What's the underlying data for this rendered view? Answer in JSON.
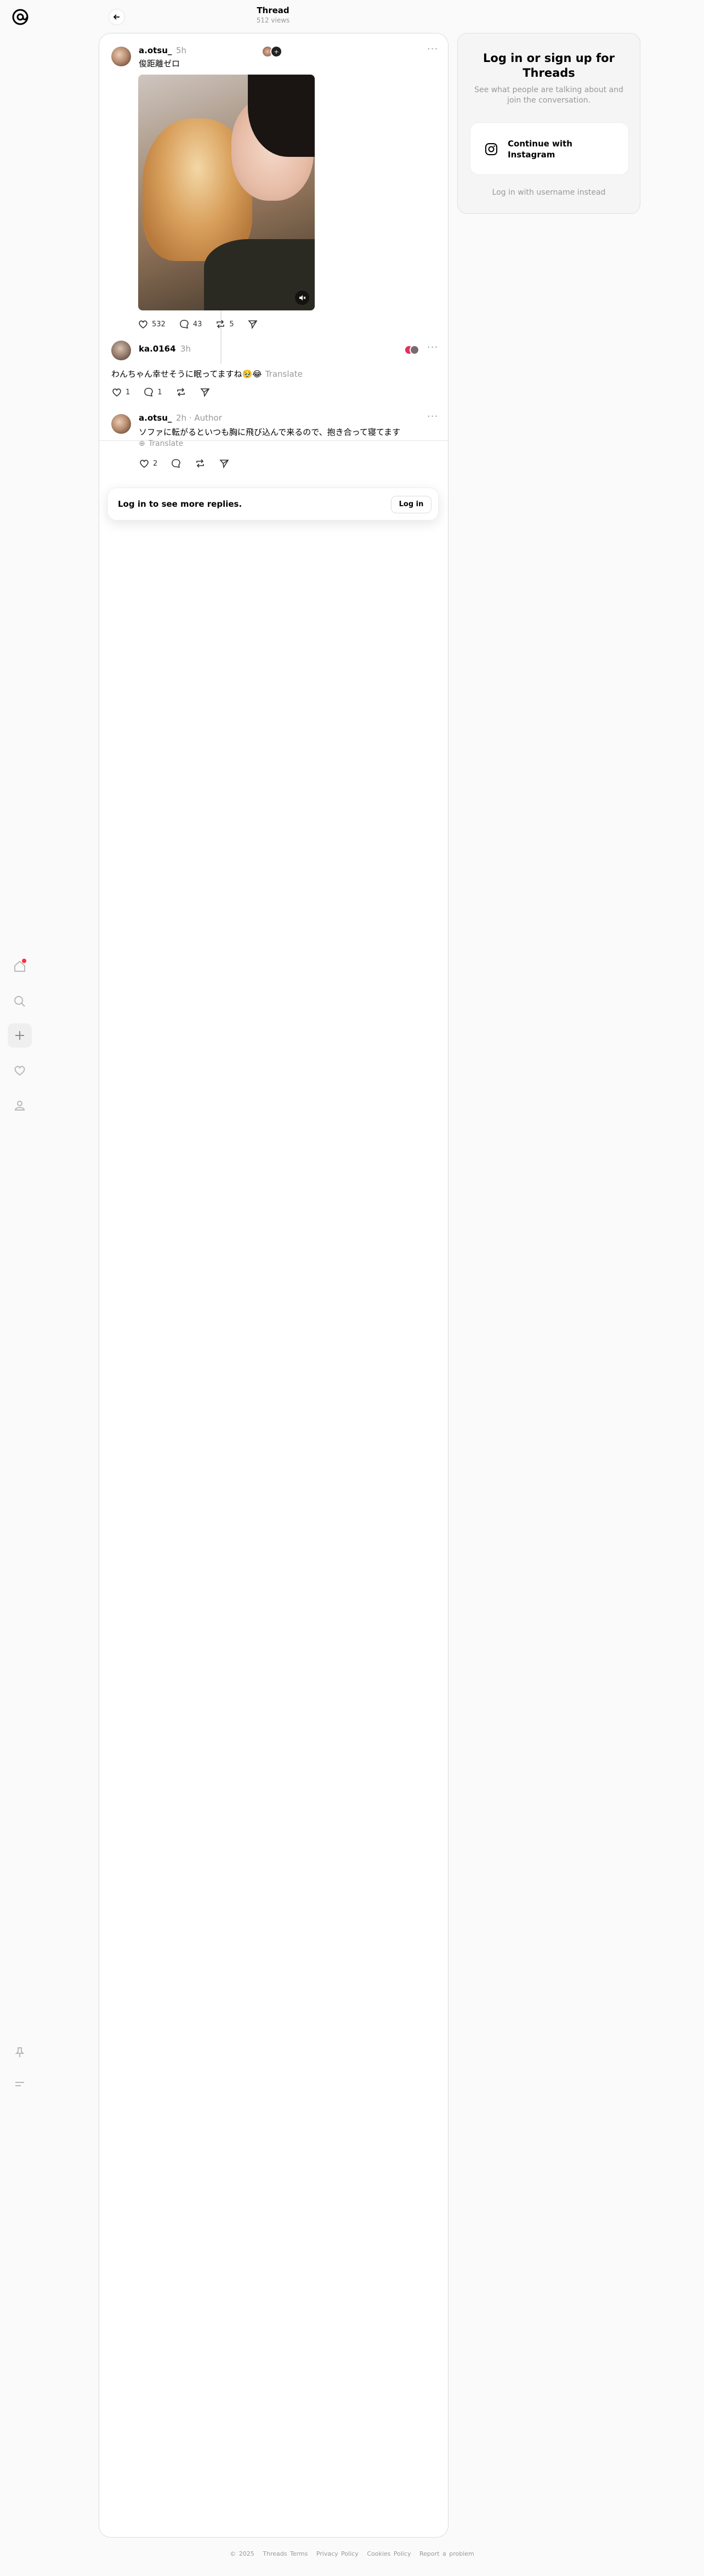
{
  "header": {
    "title": "Thread",
    "views": "512 views"
  },
  "post": {
    "username": "a.otsu_",
    "time": "5h",
    "text": "俊距離ゼロ",
    "likes": "532",
    "replies": "43",
    "reposts": "5"
  },
  "reply1": {
    "username": "ka.0164",
    "time": "3h",
    "text": "わんちゃん幸せそうに眠ってますね🥹😂",
    "translate": "Translate",
    "likes": "1",
    "replies": "1"
  },
  "reply2": {
    "username": "a.otsu_",
    "time": "2h",
    "author": "Author",
    "text": "ソファに転がるといつも胸に飛び込んで来るので、抱き合って寝てます",
    "translate": "Translate",
    "likes": "2"
  },
  "login_bar": {
    "text": "Log in to see more replies.",
    "button": "Log in"
  },
  "side": {
    "title": "Log in or sign up for Threads",
    "desc": "See what people are talking about and join the conversation.",
    "instagram_button": "Continue with Instagram",
    "username_link": "Log in with username instead"
  },
  "footer": {
    "copyright": "© 2025",
    "links": [
      "Threads Terms",
      "Privacy Policy",
      "Cookies Policy",
      "Report a problem"
    ]
  },
  "colors": {
    "notification": "#ff3040",
    "muted": "#999999",
    "border": "#dbdbdb"
  }
}
